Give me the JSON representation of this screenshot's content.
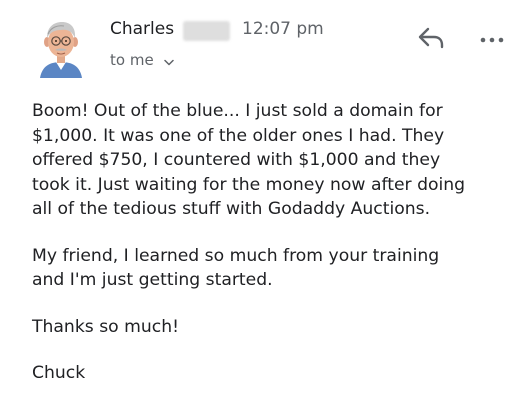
{
  "header": {
    "sender_name": "Charles",
    "time": "12:07 pm",
    "recipient_label": "to me",
    "avatar_icon": "person-avatar-illustration",
    "reply_icon": "reply-arrow-icon",
    "more_icon": "more-horizontal-icon"
  },
  "message": {
    "paragraph1": [
      "Boom!  Out of the blue... I just sold a domain for",
      "$1,000. It was one of the older ones I had. They",
      "offered $750, I countered with $1,000 and they",
      "took it. Just waiting for the money now after doing",
      "all of the tedious stuff with Godaddy Auctions."
    ],
    "paragraph2": [
      "My friend, I learned so much from your training",
      "and I'm just getting started."
    ],
    "paragraph3": "Thanks so much!",
    "signature": "Chuck"
  }
}
